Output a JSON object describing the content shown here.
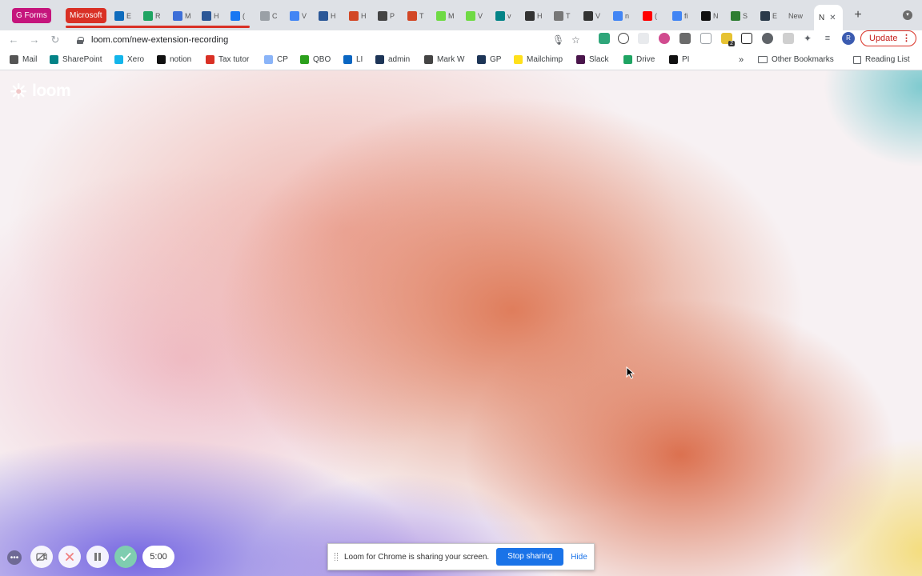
{
  "browser": {
    "tab_groups": [
      {
        "label": "G Forms",
        "color": "#c5157c"
      },
      {
        "label": "Microsoft",
        "color": "#d93025"
      }
    ],
    "tabs": [
      {
        "label": "E",
        "icon": "outlook-icon",
        "color": "#0f6cbd"
      },
      {
        "label": "R",
        "icon": "drive-icon",
        "color": "#1fa463"
      },
      {
        "label": "M",
        "icon": "c-icon",
        "color": "#3d6fd8"
      },
      {
        "label": "H",
        "icon": "word-icon",
        "color": "#2b5797"
      },
      {
        "label": "(",
        "icon": "facebook-icon",
        "color": "#1877f2"
      },
      {
        "label": "C",
        "icon": "loading-icon",
        "color": "#9aa0a6"
      },
      {
        "label": "V",
        "icon": "docs-icon",
        "color": "#4285f4"
      },
      {
        "label": "H",
        "icon": "word-icon",
        "color": "#2b5797"
      },
      {
        "label": "H",
        "icon": "powerpoint-icon",
        "color": "#d24726"
      },
      {
        "label": "P",
        "icon": "pen-icon",
        "color": "#444444"
      },
      {
        "label": "T",
        "icon": "powerpoint-icon",
        "color": "#d24726"
      },
      {
        "label": "M",
        "icon": "upwork-icon",
        "color": "#6fda44"
      },
      {
        "label": "V",
        "icon": "upwork-icon",
        "color": "#6fda44"
      },
      {
        "label": "v",
        "icon": "sharepoint-icon",
        "color": "#038387"
      },
      {
        "label": "H",
        "icon": "t-icon",
        "color": "#333333"
      },
      {
        "label": "T",
        "icon": "bookmark-icon",
        "color": "#777777"
      },
      {
        "label": "V",
        "icon": "circle-p-icon",
        "color": "#333333"
      },
      {
        "label": "n",
        "icon": "google-icon",
        "color": "#4285f4"
      },
      {
        "label": "(",
        "icon": "youtube-icon",
        "color": "#ff0000"
      },
      {
        "label": "fi",
        "icon": "google-icon",
        "color": "#4285f4"
      },
      {
        "label": "N",
        "icon": "notion-icon",
        "color": "#111111"
      },
      {
        "label": "S",
        "icon": "check-icon",
        "color": "#2e7d32"
      },
      {
        "label": "E",
        "icon": "b-icon",
        "color": "#2b3a4a"
      },
      {
        "label": "New",
        "icon": "",
        "color": ""
      }
    ],
    "active_tab": {
      "label": "N"
    },
    "url": "loom.com/new-extension-recording",
    "update_label": "Update",
    "avatar_letter": "R",
    "extensions_badge": "2"
  },
  "bookmarks": [
    {
      "label": "Mail",
      "icon": "mail-icon",
      "color": "#555555"
    },
    {
      "label": "SharePoint",
      "icon": "sharepoint-icon",
      "color": "#038387"
    },
    {
      "label": "Xero",
      "icon": "xero-icon",
      "color": "#13b5ea"
    },
    {
      "label": "notion",
      "icon": "notion-icon",
      "color": "#111111"
    },
    {
      "label": "Tax tutor",
      "icon": "t-icon",
      "color": "#d93025"
    },
    {
      "label": "CP",
      "icon": "page-icon",
      "color": "#8ab4f8"
    },
    {
      "label": "QBO",
      "icon": "quickbooks-icon",
      "color": "#2ca01c"
    },
    {
      "label": "LI",
      "icon": "linkedin-icon",
      "color": "#0a66c2"
    },
    {
      "label": "admin",
      "icon": "gp-icon",
      "color": "#1d3557"
    },
    {
      "label": "Mark W",
      "icon": "bookmark-icon",
      "color": "#444444"
    },
    {
      "label": "GP",
      "icon": "gp-icon",
      "color": "#1d3557"
    },
    {
      "label": "Mailchimp",
      "icon": "mailchimp-icon",
      "color": "#ffe01b"
    },
    {
      "label": "Slack",
      "icon": "slack-icon",
      "color": "#4a154b"
    },
    {
      "label": "Drive",
      "icon": "drive-icon",
      "color": "#1fa463"
    },
    {
      "label": "PI",
      "icon": "p-icon",
      "color": "#111111"
    }
  ],
  "bookmarks_overflow": "»",
  "other_bookmarks": "Other Bookmarks",
  "reading_list": "Reading List",
  "page": {
    "logo_text": "loom"
  },
  "loom_controls": {
    "timer": "5:00"
  },
  "sharing_bar": {
    "message": "Loom for Chrome is sharing your screen.",
    "stop_label": "Stop sharing",
    "hide_label": "Hide"
  }
}
